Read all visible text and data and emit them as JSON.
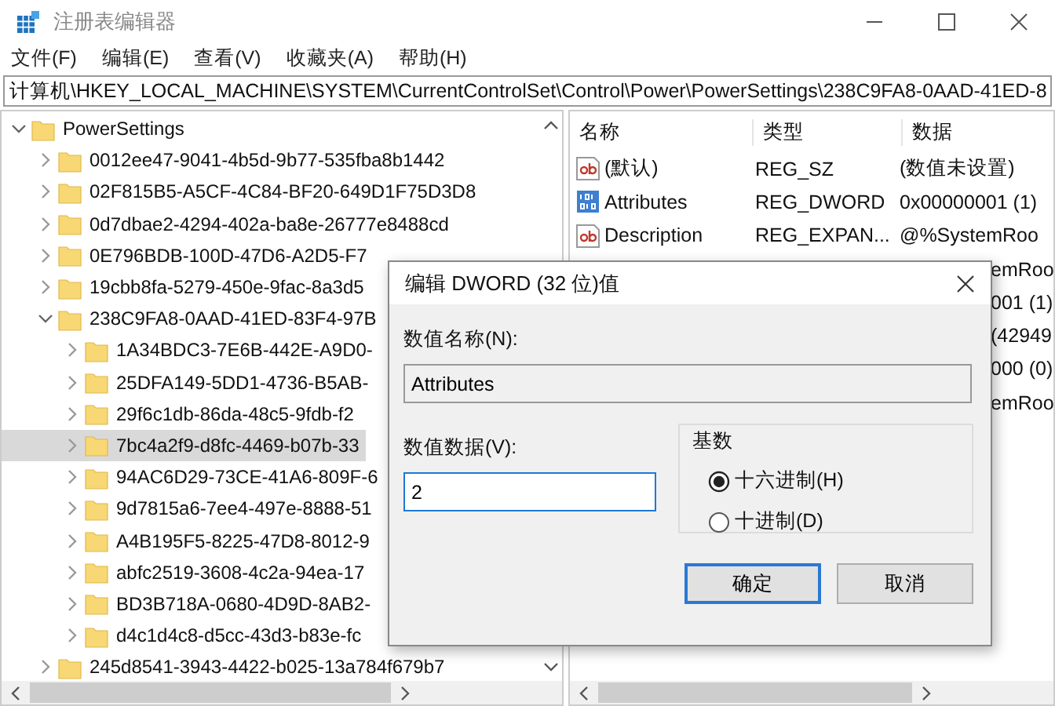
{
  "window": {
    "title": "注册表编辑器"
  },
  "menu": [
    "文件(F)",
    "编辑(E)",
    "查看(V)",
    "收藏夹(A)",
    "帮助(H)"
  ],
  "address": "计算机\\HKEY_LOCAL_MACHINE\\SYSTEM\\CurrentControlSet\\Control\\Power\\PowerSettings\\238C9FA8-0AAD-41ED-8",
  "tree": [
    {
      "label": "PowerSettings",
      "expanded": true,
      "selected": false,
      "children": [
        {
          "label": "0012ee47-9041-4b5d-9b77-535fba8b1442",
          "expanded": false,
          "selected": false
        },
        {
          "label": "02F815B5-A5CF-4C84-BF20-649D1F75D3D8",
          "expanded": false,
          "selected": false
        },
        {
          "label": "0d7dbae2-4294-402a-ba8e-26777e8488cd",
          "expanded": false,
          "selected": false
        },
        {
          "label": "0E796BDB-100D-47D6-A2D5-F7",
          "expanded": false,
          "selected": false
        },
        {
          "label": "19cbb8fa-5279-450e-9fac-8a3d5",
          "expanded": false,
          "selected": false
        },
        {
          "label": "238C9FA8-0AAD-41ED-83F4-97B",
          "expanded": true,
          "selected": false,
          "children": [
            {
              "label": "1A34BDC3-7E6B-442E-A9D0-",
              "expanded": false,
              "selected": false
            },
            {
              "label": "25DFA149-5DD1-4736-B5AB-",
              "expanded": false,
              "selected": false
            },
            {
              "label": "29f6c1db-86da-48c5-9fdb-f2",
              "expanded": false,
              "selected": false
            },
            {
              "label": "7bc4a2f9-d8fc-4469-b07b-33",
              "expanded": false,
              "selected": true
            },
            {
              "label": "94AC6D29-73CE-41A6-809F-6",
              "expanded": false,
              "selected": false
            },
            {
              "label": "9d7815a6-7ee4-497e-8888-51",
              "expanded": false,
              "selected": false
            },
            {
              "label": "A4B195F5-8225-47D8-8012-9",
              "expanded": false,
              "selected": false
            },
            {
              "label": "abfc2519-3608-4c2a-94ea-17",
              "expanded": false,
              "selected": false
            },
            {
              "label": "BD3B718A-0680-4D9D-8AB2-",
              "expanded": false,
              "selected": false
            },
            {
              "label": "d4c1d4c8-d5cc-43d3-b83e-fc",
              "expanded": false,
              "selected": false
            }
          ]
        },
        {
          "label": "245d8541-3943-4422-b025-13a784f679b7",
          "expanded": false,
          "selected": false
        }
      ]
    }
  ],
  "values": {
    "columns": [
      "名称",
      "类型",
      "数据"
    ],
    "rows": [
      {
        "kind": "string",
        "name": "(默认)",
        "type": "REG_SZ",
        "data": "(数值未设置)"
      },
      {
        "kind": "dword",
        "name": "Attributes",
        "type": "REG_DWORD",
        "data": "0x00000001 (1)"
      },
      {
        "kind": "string",
        "name": "Description",
        "type": "REG_EXPAN...",
        "data": "@%SystemRoo"
      },
      {
        "kind": "fragment",
        "data": "emRoo"
      },
      {
        "kind": "fragment",
        "data": "001 (1)"
      },
      {
        "kind": "fragment",
        "data": "(42949"
      },
      {
        "kind": "fragment",
        "data": "000 (0)"
      },
      {
        "kind": "fragment",
        "data": "emRoo"
      }
    ]
  },
  "dialog": {
    "title": "编辑 DWORD (32 位)值",
    "name_label": "数值名称(N):",
    "name_value": "Attributes",
    "data_label": "数值数据(V):",
    "data_value": "2",
    "base_label": "基数",
    "radios": [
      {
        "label": "十六进制(H)",
        "selected": true
      },
      {
        "label": "十进制(D)",
        "selected": false
      }
    ],
    "buttons": [
      {
        "label": "确定",
        "default": true
      },
      {
        "label": "取消",
        "default": false
      }
    ]
  }
}
